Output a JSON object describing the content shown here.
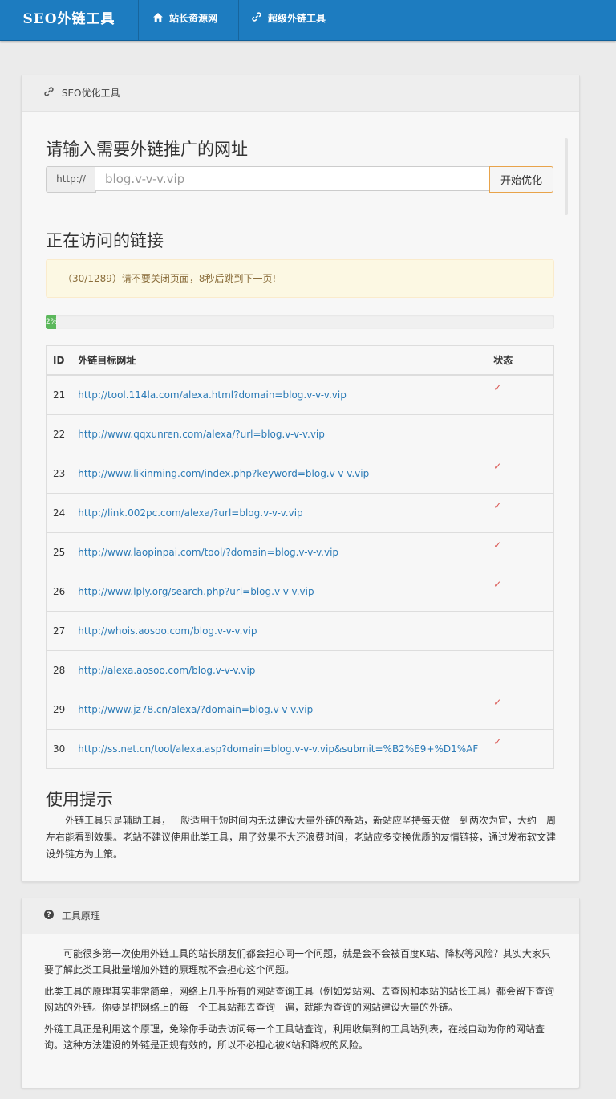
{
  "header": {
    "brand": "SEO外链工具",
    "nav": [
      {
        "label": "站长资源网",
        "icon": "home-icon"
      },
      {
        "label": "超级外链工具",
        "icon": "link-icon"
      }
    ]
  },
  "panel": {
    "title": "SEO优化工具",
    "title_icon": "link-icon",
    "input_heading": "请输入需要外链推广的网址",
    "url_prefix": "http://",
    "url_value": "blog.v-v-v.vip",
    "submit_label": "开始优化",
    "visiting_heading": "正在访问的链接",
    "alert_text": "（30/1289）请不要关闭页面，8秒后跳到下一页!",
    "progress": {
      "percent": 2,
      "label": "2%"
    },
    "table": {
      "headers": [
        "ID",
        "外链目标网址",
        "状态"
      ],
      "rows": [
        {
          "id": "21",
          "url": "http://tool.114la.com/alexa.html?domain=blog.v-v-v.vip",
          "status": "✓"
        },
        {
          "id": "22",
          "url": "http://www.qqxunren.com/alexa/?url=blog.v-v-v.vip",
          "status": ""
        },
        {
          "id": "23",
          "url": "http://www.likinming.com/index.php?keyword=blog.v-v-v.vip",
          "status": "✓"
        },
        {
          "id": "24",
          "url": "http://link.002pc.com/alexa/?url=blog.v-v-v.vip",
          "status": "✓"
        },
        {
          "id": "25",
          "url": "http://www.laopinpai.com/tool/?domain=blog.v-v-v.vip",
          "status": "✓"
        },
        {
          "id": "26",
          "url": "http://www.lply.org/search.php?url=blog.v-v-v.vip",
          "status": "✓"
        },
        {
          "id": "27",
          "url": "http://whois.aosoo.com/blog.v-v-v.vip",
          "status": ""
        },
        {
          "id": "28",
          "url": "http://alexa.aosoo.com/blog.v-v-v.vip",
          "status": ""
        },
        {
          "id": "29",
          "url": "http://www.jz78.cn/alexa/?domain=blog.v-v-v.vip",
          "status": "✓"
        },
        {
          "id": "30",
          "url": "http://ss.net.cn/tool/alexa.asp?domain=blog.v-v-v.vip&submit=%B2%E9+%D1%AF",
          "status": "✓"
        }
      ]
    },
    "tips_heading": "使用提示",
    "tips_text": "外链工具只是辅助工具，一般适用于短时间内无法建设大量外链的新站，新站应坚持每天做一到两次为宜，大约一周左右能看到效果。老站不建议使用此类工具，用了效果不大还浪费时间，老站应多交换优质的友情链接，通过发布软文建设外链方为上策。"
  },
  "principle": {
    "title": "工具原理",
    "title_icon": "question-circle-icon",
    "paragraphs": [
      "可能很多第一次使用外链工具的站长朋友们都会担心同一个问题，就是会不会被百度K站、降权等风险？其实大家只要了解此类工具批量增加外链的原理就不会担心这个问题。",
      "此类工具的原理其实非常简单，网络上几乎所有的网站查询工具（例如爱站网、去查网和本站的站长工具）都会留下查询网站的外链。你要是把网络上的每一个工具站都去查询一遍，就能为查询的网站建设大量的外链。",
      "外链工具正是利用这个原理，免除你手动去访问每一个工具站查询，利用收集到的工具站列表，在线自动为你的网站查询。这种方法建设的外链是正规有效的，所以不必担心被K站和降权的风险。"
    ]
  }
}
